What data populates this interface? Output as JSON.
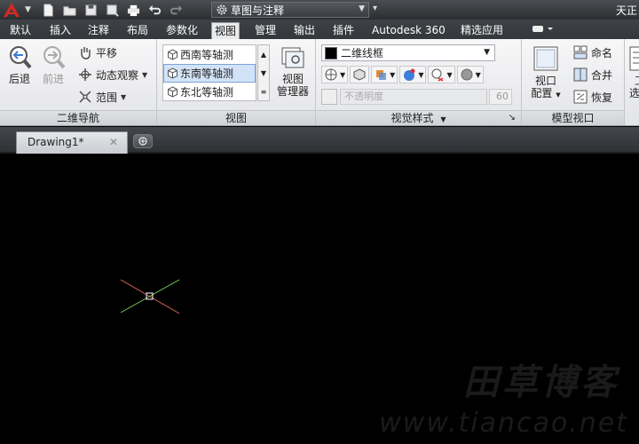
{
  "titlebar": {
    "workspace": "草图与注释",
    "title_right": "天正"
  },
  "ribbon_tabs": [
    "默认",
    "插入",
    "注释",
    "布局",
    "参数化",
    "视图",
    "管理",
    "输出",
    "插件",
    "Autodesk 360",
    "精选应用"
  ],
  "active_tab": "视图",
  "nav_panel": {
    "title": "二维导航",
    "back": "后退",
    "forward": "前进",
    "pan": "平移",
    "orbit": "动态观察",
    "extents": "范围"
  },
  "views_panel": {
    "title": "视图",
    "items": [
      "西南等轴测",
      "东南等轴测",
      "东北等轴测"
    ],
    "selected_index": 1,
    "manager_line1": "视图",
    "manager_line2": "管理器"
  },
  "visual_styles_panel": {
    "title": "视觉样式",
    "current_style": "二维线框",
    "opacity_label": "不透明度",
    "opacity_value": "60"
  },
  "model_viewports_panel": {
    "title": "模型视口",
    "config_line1": "视口",
    "config_line2": "配置",
    "named": "命名",
    "join": "合并",
    "restore": "恢复",
    "next_line1": "工",
    "next_line2": "选项"
  },
  "file_tabs": [
    {
      "label": "Drawing1*"
    }
  ],
  "watermark": {
    "text": "田草博客",
    "url": "www.tiancao.net"
  },
  "colors": {
    "canvas": "#000000",
    "crosshair_x": "#e06a5a",
    "crosshair_y": "#7ecf55"
  }
}
